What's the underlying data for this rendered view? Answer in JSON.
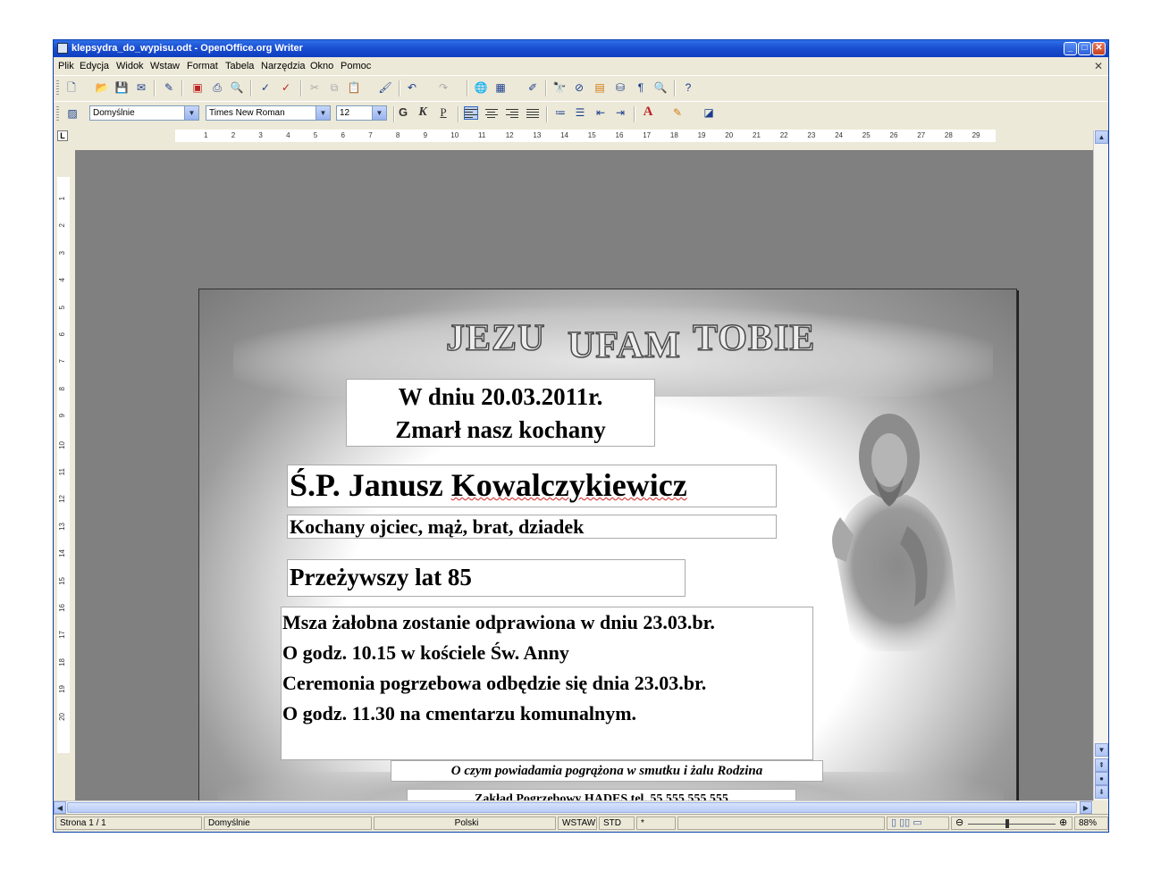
{
  "window": {
    "title": "klepsydra_do_wypisu.odt - OpenOffice.org Writer"
  },
  "menu": [
    "Plik",
    "Edycja",
    "Widok",
    "Wstaw",
    "Format",
    "Tabela",
    "Narzędzia",
    "Okno",
    "Pomoc"
  ],
  "format_toolbar": {
    "style": "Domyślnie",
    "font": "Times New Roman",
    "size": "12",
    "bold_label": "G",
    "italic_label": "K",
    "underline_label": "P"
  },
  "ruler": {
    "h_ticks": [
      "1",
      "2",
      "3",
      "4",
      "5",
      "6",
      "7",
      "8",
      "9",
      "10",
      "11",
      "12",
      "13",
      "14",
      "15",
      "16",
      "17",
      "18",
      "19",
      "20",
      "21",
      "22",
      "23",
      "24",
      "25",
      "26",
      "27",
      "28",
      "29"
    ],
    "v_ticks": [
      "1",
      "2",
      "3",
      "4",
      "5",
      "6",
      "7",
      "8",
      "9",
      "10",
      "11",
      "12",
      "13",
      "14",
      "15",
      "16",
      "17",
      "18",
      "19",
      "20"
    ]
  },
  "document": {
    "banner_words": [
      "JEZU",
      "UFAM",
      "TOBIE"
    ],
    "date_line1": "W dniu 20.03.2011r.",
    "date_line2": "Zmarł nasz kochany",
    "name_prefix": "Ś.P. Janusz ",
    "name_surname": "Kowalczykiewicz",
    "relations": "Kochany ojciec, mąż, brat, dziadek",
    "age": "Przeżywszy lat 85",
    "mass_lines": [
      "Msza żałobna zostanie odprawiona w dniu 23.03.br.",
      "O godz. 10.15 w kościele Św. Anny",
      "Ceremonia pogrzebowa odbędzie się  dnia 23.03.br.",
      "O godz. 11.30 na cmentarzu komunalnym."
    ],
    "family_note": "O czym powiadamia pogrążona w smutku i żalu Rodzina",
    "funeral_home": "Zakład Pogrzebowy HADES tel. 55 555 555 555"
  },
  "statusbar": {
    "page": "Strona  1 / 1",
    "style": "Domyślnie",
    "language": "Polski",
    "insert_mode": "WSTAW",
    "selection_mode": "STD",
    "modified": "*",
    "zoom": "88%"
  },
  "colors": {
    "titlebar": "#1a4fd1",
    "chrome": "#ece9d8",
    "workspace": "#808080"
  }
}
